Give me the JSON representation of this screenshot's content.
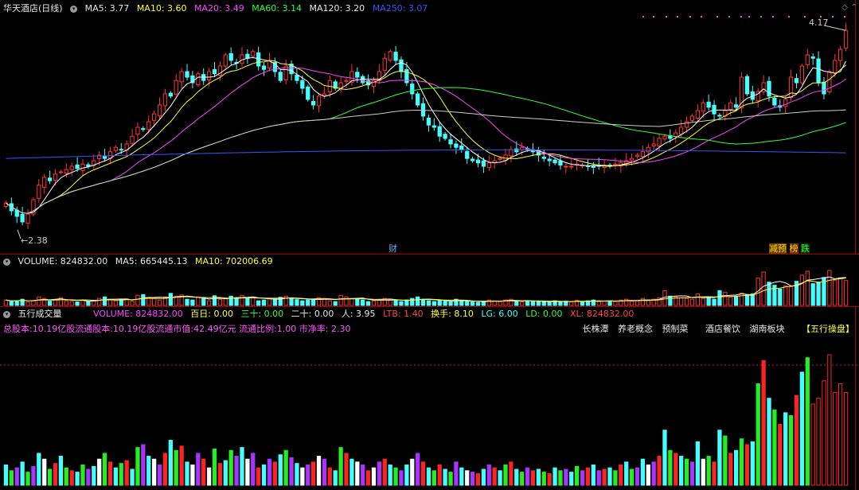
{
  "header": {
    "title": "华天酒店(日线)",
    "ma5": "MA5: 3.77",
    "ma10": "MA10: 3.60",
    "ma20": "MA20: 3.49",
    "ma60": "MA60: 3.14",
    "ma120": "MA120: 3.20",
    "ma250": "MA250: 3.07"
  },
  "price_labels": {
    "high": "4.17",
    "low": "2.38",
    "cai": "财",
    "yu": "预",
    "bang": "榜",
    "die": "跌",
    "jian": "减"
  },
  "volume_header": {
    "volume": "VOLUME: 824832.00",
    "ma5": "MA5: 665445.13",
    "ma10": "MA10: 702006.69"
  },
  "wuxing_header": {
    "title": "五行成交量",
    "volume": "VOLUME: 824832.00",
    "bairi": "百日: 0.00",
    "sanshi": "三十: 0.00",
    "ershi": "二十: 0.00",
    "ren": "人: 3.95",
    "ltb": "LTB: 1.40",
    "huanshou": "换手: 8.10",
    "lg": "LG: 6.00",
    "ld": "LD: 0.00",
    "xl": "XL: 824832.00"
  },
  "info_line": "总股本:10.19亿股流通股本:10.19亿股流通市值:42.49亿元 流通比例:1.00 市净率: 2.30",
  "tags": [
    "长株潭",
    "养老概念",
    "预制菜",
    "酒店餐饮",
    "湖南板块",
    "【五行操盘】"
  ],
  "colors": {
    "up": "#ff3333",
    "down": "#44ffff",
    "ma5": "#ffffff",
    "ma10": "#ffff33",
    "ma20": "#ff44ff",
    "ma60": "#33ff33",
    "ma120": "#cccccc",
    "ma250": "#3355ff"
  },
  "chart_data": {
    "type": "candlestick",
    "ylim": [
      2.3,
      4.3
    ],
    "close": [
      2.62,
      2.55,
      2.5,
      2.45,
      2.52,
      2.65,
      2.78,
      2.85,
      2.82,
      2.88,
      2.9,
      2.92,
      2.95,
      2.93,
      2.97,
      2.95,
      3.0,
      3.05,
      3.02,
      3.08,
      3.12,
      3.1,
      3.15,
      3.22,
      3.3,
      3.28,
      3.35,
      3.42,
      3.5,
      3.6,
      3.58,
      3.72,
      3.8,
      3.75,
      3.7,
      3.78,
      3.72,
      3.8,
      3.78,
      3.85,
      3.95,
      3.9,
      3.88,
      3.95,
      3.92,
      3.98,
      3.85,
      3.82,
      3.9,
      3.8,
      3.72,
      3.85,
      3.78,
      3.72,
      3.65,
      3.55,
      3.5,
      3.58,
      3.6,
      3.72,
      3.65,
      3.7,
      3.72,
      3.8,
      3.75,
      3.7,
      3.68,
      3.72,
      3.8,
      3.92,
      3.98,
      3.9,
      3.8,
      3.7,
      3.6,
      3.5,
      3.4,
      3.32,
      3.3,
      3.22,
      3.2,
      3.15,
      3.12,
      3.1,
      3.02,
      3.0,
      2.98,
      2.95,
      2.98,
      3.0,
      3.02,
      3.05,
      3.1,
      3.08,
      3.12,
      3.1,
      3.08,
      3.05,
      3.02,
      3.0,
      2.98,
      2.96,
      2.95,
      2.95,
      2.97,
      2.96,
      2.95,
      2.94,
      2.95,
      2.96,
      2.95,
      2.97,
      2.98,
      3.0,
      3.02,
      3.05,
      3.08,
      3.12,
      3.15,
      3.2,
      3.22,
      3.2,
      3.25,
      3.3,
      3.35,
      3.4,
      3.45,
      3.52,
      3.48,
      3.42,
      3.4,
      3.45,
      3.52,
      3.48,
      3.75,
      3.6,
      3.55,
      3.62,
      3.7,
      3.58,
      3.5,
      3.48,
      3.55,
      3.75,
      3.7,
      3.85,
      3.95,
      3.92,
      3.7,
      3.6,
      3.8,
      3.9,
      4.0,
      4.17
    ],
    "ma5_last": 3.77,
    "ma10_last": 3.6,
    "ma20_last": 3.49,
    "ma60_last": 3.14,
    "ma120_last": 3.2,
    "ma250_last": 3.07,
    "high_marker": 4.17,
    "low_marker": 2.38,
    "volume_last": 824832.0,
    "volume": [
      14,
      10,
      12,
      16,
      9,
      13,
      22,
      18,
      11,
      15,
      20,
      12,
      10,
      9,
      14,
      11,
      13,
      18,
      22,
      16,
      12,
      15,
      17,
      11,
      26,
      28,
      20,
      18,
      14,
      22,
      31,
      24,
      27,
      16,
      14,
      22,
      18,
      12,
      25,
      15,
      17,
      24,
      20,
      26,
      18,
      22,
      12,
      14,
      18,
      16,
      21,
      24,
      19,
      15,
      12,
      14,
      16,
      20,
      18,
      12,
      10,
      26,
      22,
      18,
      16,
      14,
      10,
      12,
      16,
      18,
      14,
      12,
      10,
      14,
      18,
      22,
      16,
      12,
      10,
      14,
      11,
      9,
      16,
      12,
      10,
      9,
      8,
      11,
      14,
      12,
      10,
      14,
      16,
      11,
      9,
      12,
      10,
      11,
      9,
      8,
      12,
      10,
      11,
      9,
      13,
      10,
      12,
      14,
      10,
      11,
      12,
      10,
      14,
      16,
      11,
      12,
      18,
      14,
      16,
      20,
      38,
      24,
      22,
      20,
      18,
      16,
      30,
      18,
      20,
      16,
      38,
      34,
      22,
      24,
      32,
      28,
      30,
      70,
      86,
      60,
      52,
      42,
      50,
      48,
      62,
      78,
      88,
      56,
      60,
      72,
      90,
      64,
      70,
      64
    ]
  }
}
